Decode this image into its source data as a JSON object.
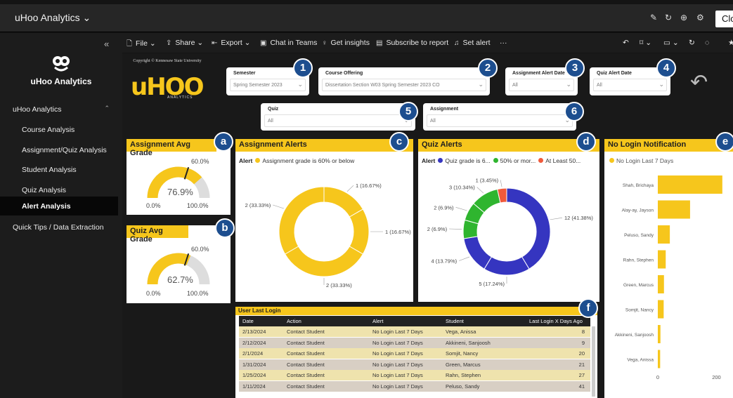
{
  "titlebar": {
    "title": "uHoo Analytics",
    "close_label": "Clo"
  },
  "sidebar": {
    "app_name": "uHoo Analytics",
    "items": [
      {
        "label": "uHoo Analytics"
      },
      {
        "label": "Course Analysis"
      },
      {
        "label": "Assignment/Quiz Analysis"
      },
      {
        "label": "Student Analysis"
      },
      {
        "label": "Quiz Analysis"
      },
      {
        "label": "Alert Analysis"
      },
      {
        "label": "Quick Tips / Data Extraction"
      }
    ]
  },
  "toolbar": {
    "file": "File",
    "share": "Share",
    "export": "Export",
    "chat": "Chat in Teams",
    "insights": "Get insights",
    "subscribe": "Subscribe to report",
    "alert": "Set alert",
    "more": "···"
  },
  "brand": {
    "copyright": "Copyright © Kennesaw State University",
    "logo_text": "uHOO",
    "logo_sub": "ANALYTICS"
  },
  "slicers": [
    {
      "label": "Semester",
      "value": "Spring Semester 2023"
    },
    {
      "label": "Course Offering",
      "value": "Dissertation Section W03 Spring Semester 2023 CO"
    },
    {
      "label": "Assignment Alert Date",
      "value": "All"
    },
    {
      "label": "Quiz Alert Date",
      "value": "All"
    },
    {
      "label": "Quiz",
      "value": "All"
    },
    {
      "label": "Assignment",
      "value": "All"
    }
  ],
  "badges": [
    "1",
    "2",
    "3",
    "4",
    "5",
    "6",
    "a",
    "b",
    "c",
    "d",
    "e",
    "f"
  ],
  "gauges": [
    {
      "title": "Assignment Avg Grade",
      "value_label": "76.9%",
      "value": 0.769,
      "target_label": "60.0%",
      "target": 0.6,
      "min": "0.0%",
      "max": "100.0%"
    },
    {
      "title": "Quiz Avg Grade",
      "value_label": "62.7%",
      "value": 0.627,
      "target_label": "60.0%",
      "target": 0.6,
      "min": "0.0%",
      "max": "100.0%"
    }
  ],
  "assignment_alerts": {
    "title": "Assignment Alerts",
    "legend_title": "Alert",
    "legend_item": "Assignment grade is 60% or below",
    "color": "#f6c61c",
    "slices": [
      {
        "label": "1 (16.67%)",
        "value": 1
      },
      {
        "label": "1 (16.67%)",
        "value": 1
      },
      {
        "label": "2 (33.33%)",
        "value": 2
      },
      {
        "label": "2 (33.33%)",
        "value": 2
      }
    ]
  },
  "quiz_alerts": {
    "title": "Quiz Alerts",
    "legend_title": "Alert",
    "legend_items": [
      {
        "label": "Quiz grade is 6...",
        "color": "#3535c0"
      },
      {
        "label": "50% or mor...",
        "color": "#2fb52f"
      },
      {
        "label": "At Least 50...",
        "color": "#f05a3c"
      }
    ],
    "slices": [
      {
        "label": "12 (41.38%)",
        "value": 12,
        "color": "#3535c0"
      },
      {
        "label": "5 (17.24%)",
        "value": 5,
        "color": "#3535c0"
      },
      {
        "label": "4 (13.79%)",
        "value": 4,
        "color": "#3535c0"
      },
      {
        "label": "2 (6.9%)",
        "value": 2,
        "color": "#2fb52f"
      },
      {
        "label": "2 (6.9%)",
        "value": 2,
        "color": "#2fb52f"
      },
      {
        "label": "3 (10.34%)",
        "value": 3,
        "color": "#2fb52f"
      },
      {
        "label": "1 (3.45%)",
        "value": 1,
        "color": "#f05a3c"
      }
    ]
  },
  "no_login": {
    "title": "No Login Notification",
    "legend_item": "No Login Last 7 Days",
    "axis_ticks": [
      "0",
      "200"
    ],
    "axis_max": 230,
    "bars": [
      {
        "name": "Shah, Brichaya",
        "value": 220
      },
      {
        "name": "Alay-ay, Jayson",
        "value": 110
      },
      {
        "name": "Peluso, Sandy",
        "value": 41
      },
      {
        "name": "Rahn, Stephen",
        "value": 27
      },
      {
        "name": "Green, Marcus",
        "value": 21
      },
      {
        "name": "Somjit, Nancy",
        "value": 20
      },
      {
        "name": "Akkineni, Sanjoosh",
        "value": 9
      },
      {
        "name": "Vega, Anissa",
        "value": 8
      }
    ]
  },
  "user_last_login": {
    "title": "User Last Login",
    "columns": [
      "Date",
      "Action",
      "Alert",
      "Student",
      "Last Login X Days Ago"
    ],
    "rows": [
      [
        "2/13/2024",
        "Contact Student",
        "No Login Last 7 Days",
        "Vega, Anissa",
        "8"
      ],
      [
        "2/12/2024",
        "Contact Student",
        "No Login Last 7 Days",
        "Akkineni, Sanjoosh",
        "9"
      ],
      [
        "2/1/2024",
        "Contact Student",
        "No Login Last 7 Days",
        "Somjit, Nancy",
        "20"
      ],
      [
        "1/31/2024",
        "Contact Student",
        "No Login Last 7 Days",
        "Green, Marcus",
        "21"
      ],
      [
        "1/25/2024",
        "Contact Student",
        "No Login Last 7 Days",
        "Rahn, Stephen",
        "27"
      ],
      [
        "1/11/2024",
        "Contact Student",
        "No Login Last 7 Days",
        "Peluso, Sandy",
        "41"
      ]
    ]
  }
}
